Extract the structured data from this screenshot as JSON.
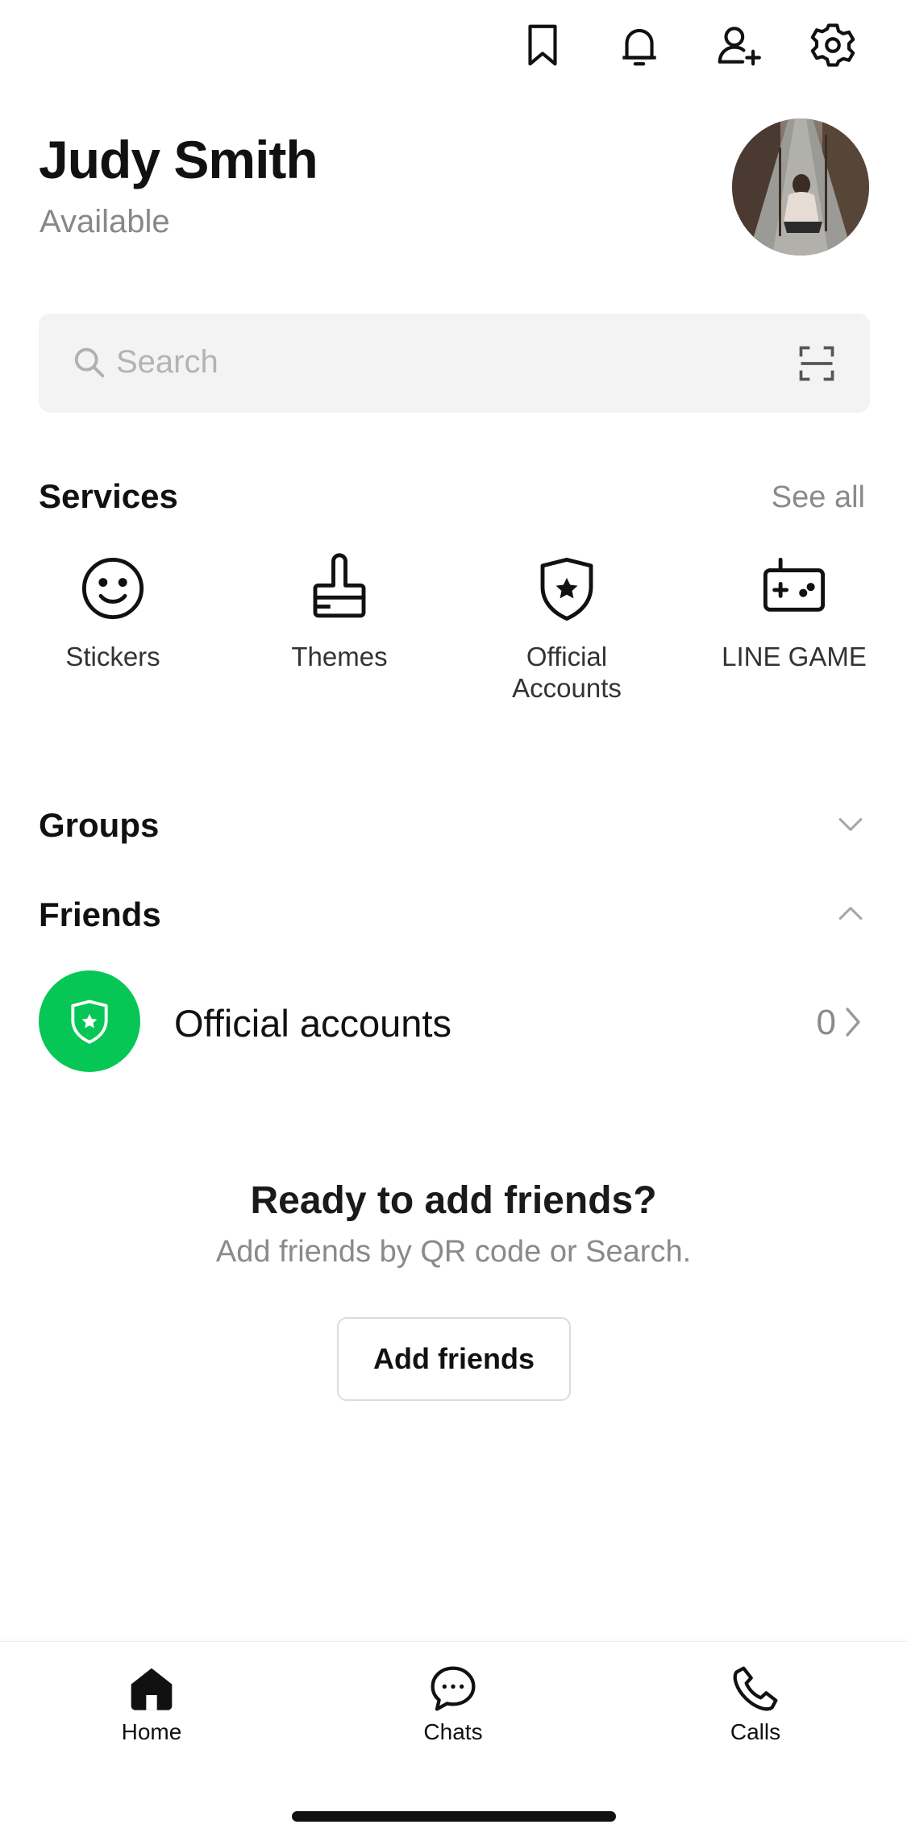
{
  "topbar": {
    "icons": [
      "bookmark-icon",
      "bell-icon",
      "add-friend-icon",
      "gear-icon"
    ]
  },
  "profile": {
    "name": "Judy Smith",
    "status": "Available"
  },
  "search": {
    "placeholder": "Search",
    "icon": "search-icon",
    "scan_icon": "scan-icon"
  },
  "services": {
    "title": "Services",
    "see_all": "See all",
    "items": [
      {
        "label": "Stickers",
        "icon": "smiley-icon"
      },
      {
        "label": "Themes",
        "icon": "brush-icon"
      },
      {
        "label": "Official Accounts",
        "icon": "shield-star-icon"
      },
      {
        "label": "LINE GAME",
        "icon": "gamepad-icon"
      }
    ]
  },
  "groups": {
    "title": "Groups",
    "state": "collapsed"
  },
  "friends": {
    "title": "Friends",
    "state": "expanded",
    "official_accounts": {
      "label": "Official accounts",
      "count": "0"
    }
  },
  "empty_state": {
    "title": "Ready to add friends?",
    "subtitle": "Add friends by QR code or Search.",
    "button": "Add friends"
  },
  "bottom_nav": {
    "items": [
      {
        "label": "Home",
        "icon": "home-icon",
        "active": true
      },
      {
        "label": "Chats",
        "icon": "chat-bubble-icon",
        "active": false
      },
      {
        "label": "Calls",
        "icon": "phone-icon",
        "active": false
      }
    ]
  },
  "colors": {
    "accent": "#06c755",
    "text_primary": "#111111",
    "text_secondary": "#8a8a8a",
    "search_bg": "#f3f3f3"
  }
}
